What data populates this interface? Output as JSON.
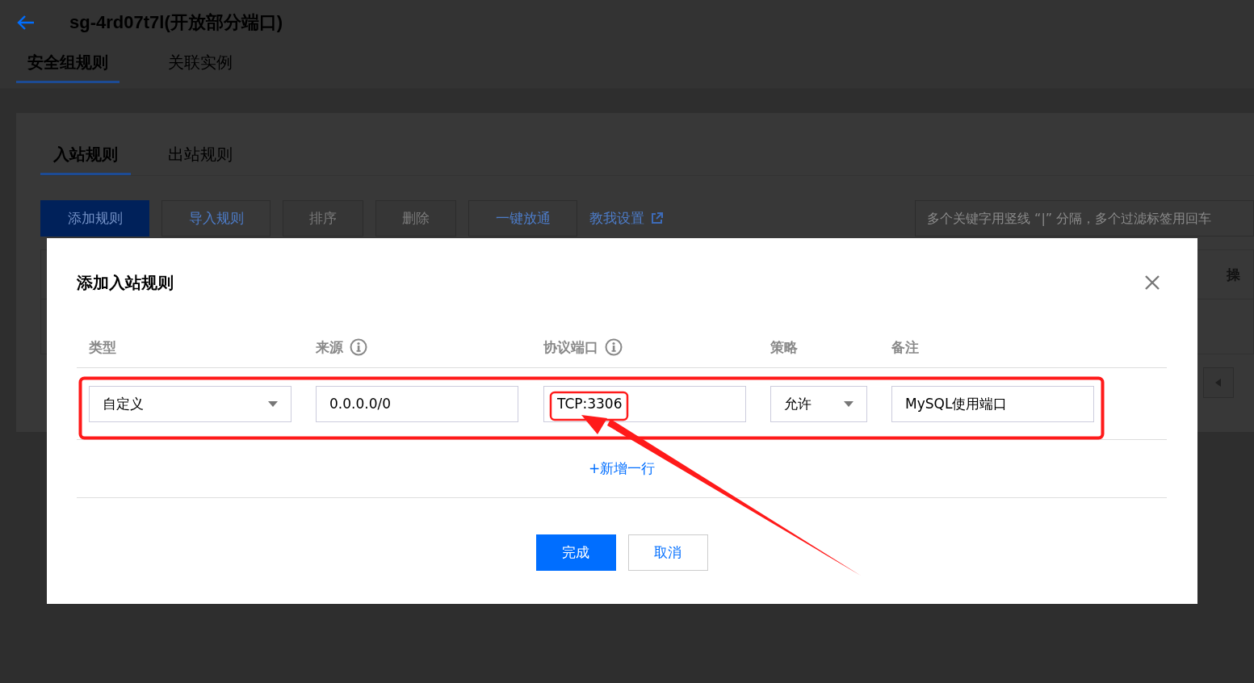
{
  "page": {
    "title": "sg-4rd07t7l(开放部分端口)",
    "tabs": [
      {
        "label": "安全组规则",
        "selected": true
      },
      {
        "label": "关联实例",
        "selected": false
      }
    ]
  },
  "panel": {
    "tabs": [
      {
        "label": "入站规则",
        "selected": true
      },
      {
        "label": "出站规则",
        "selected": false
      }
    ],
    "toolbar": [
      {
        "label": "添加规则",
        "kind": "primary",
        "disabled": false
      },
      {
        "label": "导入规则",
        "kind": "default",
        "disabled": false
      },
      {
        "label": "排序",
        "kind": "default",
        "disabled": true
      },
      {
        "label": "删除",
        "kind": "default",
        "disabled": true
      },
      {
        "label": "一键放通",
        "kind": "default",
        "disabled": false
      },
      {
        "label": "教我设置",
        "kind": "link",
        "disabled": false
      }
    ],
    "search": {
      "placeholder": "多个关键字用竖线 “|” 分隔，多个过滤标签用回车"
    },
    "table": {
      "columns": [
        "操"
      ]
    }
  },
  "dialog": {
    "title": "添加入站规则",
    "columns": [
      {
        "label": "类型",
        "kind": "plain"
      },
      {
        "label": "来源",
        "kind": "info"
      },
      {
        "label": "协议端口",
        "kind": "info"
      },
      {
        "label": "策略",
        "kind": "plain"
      },
      {
        "label": "备注",
        "kind": "plain"
      }
    ],
    "rows": [
      {
        "fields": [
          {
            "kind": "select",
            "value": "自定义"
          },
          {
            "kind": "input",
            "value": "0.0.0.0/0"
          },
          {
            "kind": "input",
            "value": "TCP:3306"
          },
          {
            "kind": "select",
            "value": "允许"
          },
          {
            "kind": "input",
            "value": "MySQL使用端口"
          }
        ]
      }
    ],
    "add_row": "+新增一行",
    "buttons": [
      {
        "label": "完成",
        "kind": "primary"
      },
      {
        "label": "取消",
        "kind": "default"
      }
    ]
  }
}
